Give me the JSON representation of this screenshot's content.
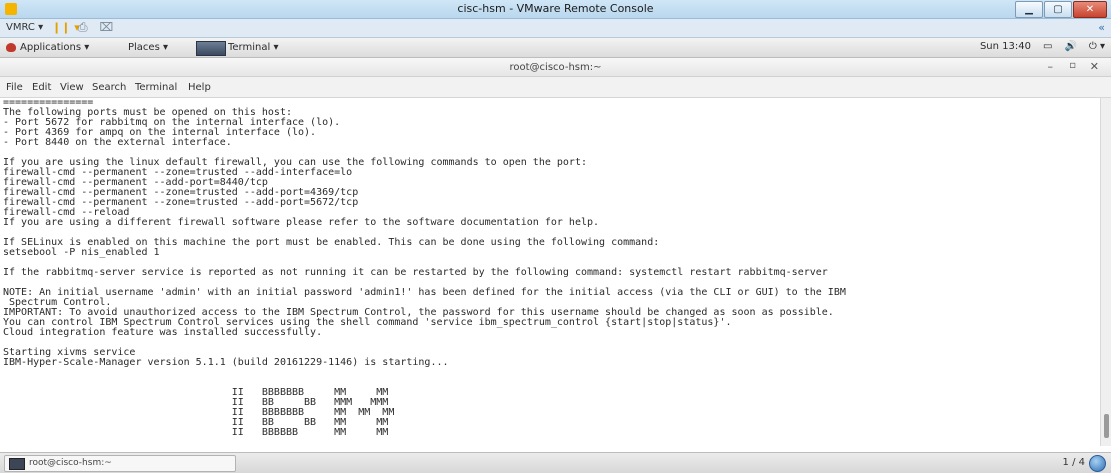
{
  "window": {
    "title": "cisc-hsm - VMware Remote Console"
  },
  "vmrc_toolbar": {
    "menu_label": "VMRC ▾",
    "pause_label": "❙❙ ▾",
    "device_icons": "⎙ ⌧",
    "expand_label": "«"
  },
  "gnome_panel": {
    "applications": "Applications ▾",
    "places": "Places ▾",
    "terminal": "Terminal ▾",
    "clock": "Sun 13:40",
    "display_icon": "▭",
    "volume_icon": "🔊",
    "power_icon": "⏻ ▾"
  },
  "terminal": {
    "title": "root@cisco-hsm:~",
    "menu": [
      "File",
      "Edit",
      "View",
      "Search",
      "Terminal",
      "Help"
    ],
    "lines": [
      "===============",
      "The following ports must be opened on this host:",
      "- Port 5672 for rabbitmq on the internal interface (lo).",
      "- Port 4369 for ampq on the internal interface (lo).",
      "- Port 8440 on the external interface.",
      "",
      "If you are using the linux default firewall, you can use the following commands to open the port:",
      "firewall-cmd --permanent --zone=trusted --add-interface=lo",
      "firewall-cmd --permanent --add-port=8440/tcp",
      "firewall-cmd --permanent --zone=trusted --add-port=4369/tcp",
      "firewall-cmd --permanent --zone=trusted --add-port=5672/tcp",
      "firewall-cmd --reload",
      "If you are using a different firewall software please refer to the software documentation for help.",
      "",
      "If SELinux is enabled on this machine the port must be enabled. This can be done using the following command:",
      "setsebool -P nis_enabled 1",
      "",
      "If the rabbitmq-server service is reported as not running it can be restarted by the following command: systemctl restart rabbitmq-server",
      "",
      "NOTE: An initial username 'admin' with an initial password 'admin1!' has been defined for the initial access (via the CLI or GUI) to the IBM",
      " Spectrum Control.",
      "IMPORTANT: To avoid unauthorized access to the IBM Spectrum Control, the password for this username should be changed as soon as possible.",
      "You can control IBM Spectrum Control services using the shell command 'service ibm_spectrum_control {start|stop|status}'.",
      "Cloud integration feature was installed successfully.",
      "",
      "Starting xivms service",
      "IBM-Hyper-Scale-Manager version 5.1.1 (build 20161229-1146) is starting...",
      "",
      "",
      "                                      II   BBBBBBB     MM     MM",
      "                                      II   BB     BB   MMM   MMM",
      "                                      II   BBBBBBB     MM  MM  MM",
      "                                      II   BB     BB   MM     MM",
      "                                      II   BBBBBB      MM     MM"
    ]
  },
  "taskbar": {
    "task_label": "root@cisco-hsm:~",
    "workspace": "1 / 4"
  }
}
